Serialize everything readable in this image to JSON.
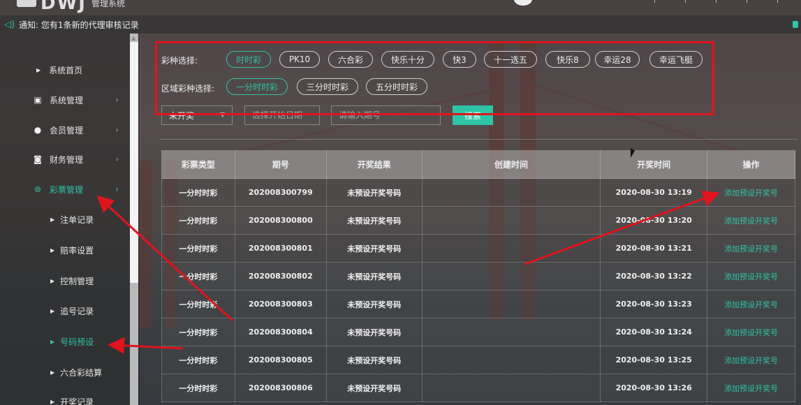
{
  "header": {
    "logo_text": "DWJ",
    "subtitle": "管理系统"
  },
  "notice": {
    "text": "通知: 您有1条新的代理审核记录"
  },
  "sidebar": {
    "home": "系统首页",
    "items": [
      {
        "label": "系统管理",
        "icon": "calendar-icon"
      },
      {
        "label": "会员管理",
        "icon": "user-icon"
      },
      {
        "label": "财务管理",
        "icon": "money-icon"
      },
      {
        "label": "彩票管理",
        "icon": "basketball-icon"
      }
    ],
    "sub_items": [
      "注单记录",
      "赔率设置",
      "控制管理",
      "追号记录",
      "号码预设",
      "六合彩结算",
      "开奖记录"
    ],
    "active_sub": "号码预设"
  },
  "filters": {
    "lottery_label": "彩种选择:",
    "lottery_types": [
      "时时彩",
      "PK10",
      "六合彩",
      "快乐十分",
      "快3",
      "十一选五",
      "快乐8",
      "幸运28",
      "幸运飞艇"
    ],
    "active_lottery": "时时彩",
    "region_label": "区域彩种选择:",
    "region_types": [
      "一分时时彩",
      "三分时时彩",
      "五分时时彩"
    ],
    "active_region": "一分时时彩",
    "status_select": "未开奖",
    "date_placeholder": "选择开始日期",
    "issue_placeholder": "请输入期号",
    "search_label": "搜索"
  },
  "table": {
    "headers": [
      "彩票类型",
      "期号",
      "开奖结果",
      "创建时间",
      "开奖时间",
      "操作"
    ],
    "rows": [
      [
        "一分时时彩",
        "202008300799",
        "未预设开奖号码",
        "",
        "2020-08-30 13:19",
        "添加预设开奖号"
      ],
      [
        "一分时时彩",
        "202008300800",
        "未预设开奖号码",
        "",
        "2020-08-30 13:20",
        "添加预设开奖号"
      ],
      [
        "一分时时彩",
        "202008300801",
        "未预设开奖号码",
        "",
        "2020-08-30 13:21",
        "添加预设开奖号"
      ],
      [
        "一分时时彩",
        "202008300802",
        "未预设开奖号码",
        "",
        "2020-08-30 13:22",
        "添加预设开奖号"
      ],
      [
        "一分时时彩",
        "202008300803",
        "未预设开奖号码",
        "",
        "2020-08-30 13:23",
        "添加预设开奖号"
      ],
      [
        "一分时时彩",
        "202008300804",
        "未预设开奖号码",
        "",
        "2020-08-30 13:24",
        "添加预设开奖号"
      ],
      [
        "一分时时彩",
        "202008300805",
        "未预设开奖号码",
        "",
        "2020-08-30 13:25",
        "添加预设开奖号"
      ],
      [
        "一分时时彩",
        "202008300806",
        "未预设开奖号码",
        "",
        "2020-08-30 13:26",
        "添加预设开奖号"
      ]
    ]
  },
  "colors": {
    "accent": "#2ec4a6",
    "annotation": "#e0141e"
  }
}
